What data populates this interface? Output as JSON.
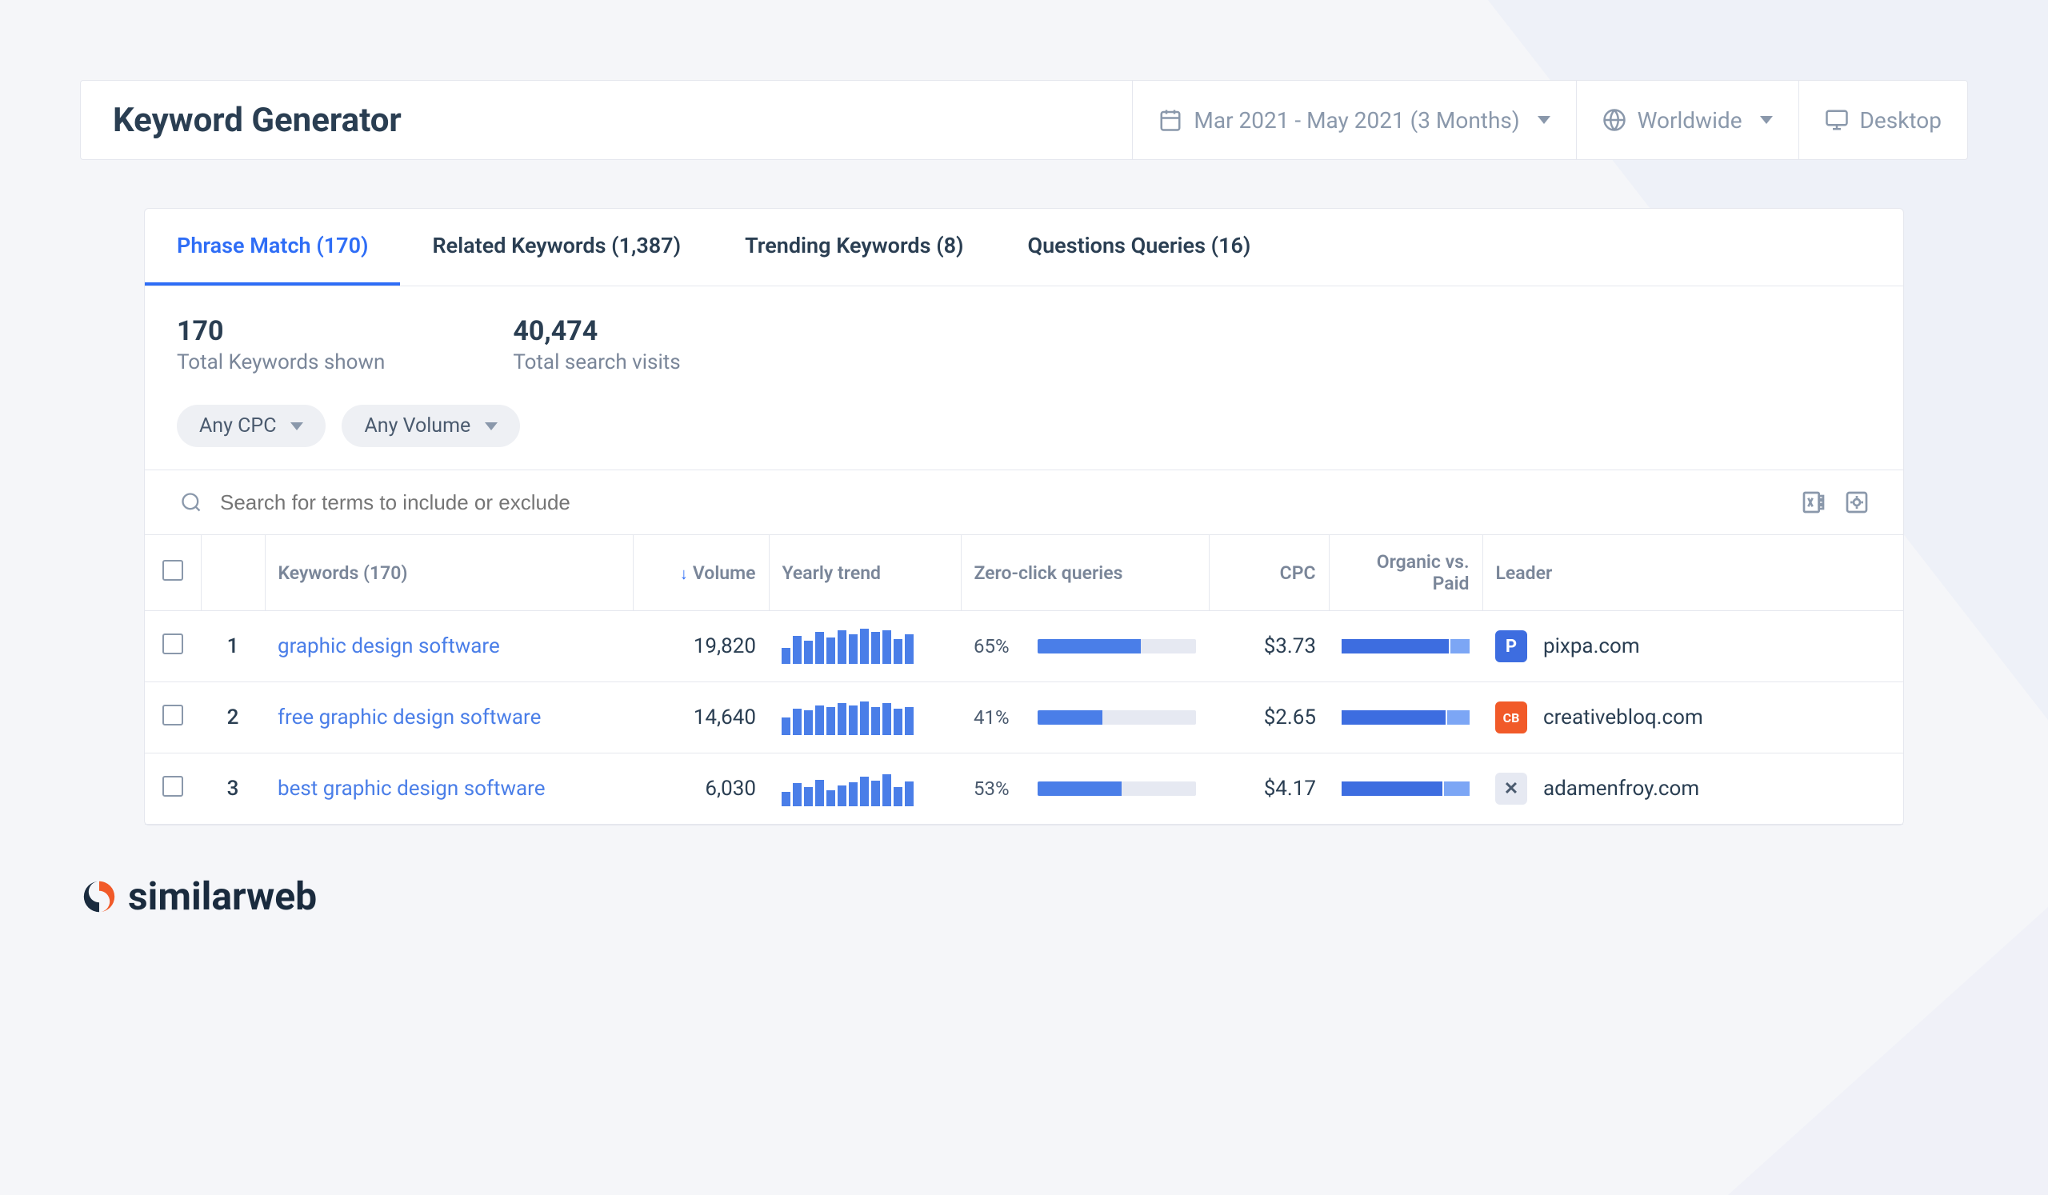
{
  "header": {
    "title": "Keyword Generator",
    "dateRange": "Mar 2021 - May 2021 (3 Months)",
    "region": "Worldwide",
    "device": "Desktop"
  },
  "tabs": [
    {
      "label": "Phrase Match (170)",
      "active": true
    },
    {
      "label": "Related Keywords (1,387)",
      "active": false
    },
    {
      "label": "Trending Keywords (8)",
      "active": false
    },
    {
      "label": "Questions Queries (16)",
      "active": false
    }
  ],
  "stats": {
    "totalKeywords": "170",
    "totalKeywordsLabel": "Total Keywords shown",
    "totalVisits": "40,474",
    "totalVisitsLabel": "Total search visits"
  },
  "chips": {
    "cpc": "Any CPC",
    "volume": "Any Volume"
  },
  "search": {
    "placeholder": "Search for terms to include or exclude"
  },
  "columns": {
    "keywords": "Keywords (170)",
    "volume": "Volume",
    "trend": "Yearly trend",
    "zero": "Zero-click queries",
    "cpc": "CPC",
    "organic": "Organic vs. Paid",
    "leader": "Leader"
  },
  "rows": [
    {
      "idx": "1",
      "keyword": "graphic design software",
      "volume": "19,820",
      "spark": [
        45,
        80,
        65,
        90,
        75,
        95,
        85,
        100,
        90,
        95,
        70,
        85
      ],
      "zeroPct": "65%",
      "zeroBar": 65,
      "cpc": "$3.73",
      "organic": 85,
      "leaderIcon": {
        "bg": "#3d6de0",
        "letter": "P"
      },
      "leader": "pixpa.com"
    },
    {
      "idx": "2",
      "keyword": "free graphic design software",
      "volume": "14,640",
      "spark": [
        50,
        75,
        70,
        85,
        80,
        90,
        85,
        95,
        80,
        90,
        75,
        80
      ],
      "zeroPct": "41%",
      "zeroBar": 41,
      "cpc": "$2.65",
      "organic": 82,
      "leaderIcon": {
        "bg": "#f15a29",
        "letter": "CB"
      },
      "leader": "creativebloq.com"
    },
    {
      "idx": "3",
      "keyword": "best graphic design software",
      "volume": "6,030",
      "spark": [
        40,
        65,
        55,
        75,
        45,
        60,
        68,
        85,
        72,
        90,
        55,
        70
      ],
      "zeroPct": "53%",
      "zeroBar": 53,
      "cpc": "$4.17",
      "organic": 80,
      "leaderIcon": {
        "bg": "#e6e9f2",
        "letter": "✕",
        "fg": "#4a5a6e"
      },
      "leader": "adamenfroy.com"
    }
  ],
  "logo": "similarweb"
}
